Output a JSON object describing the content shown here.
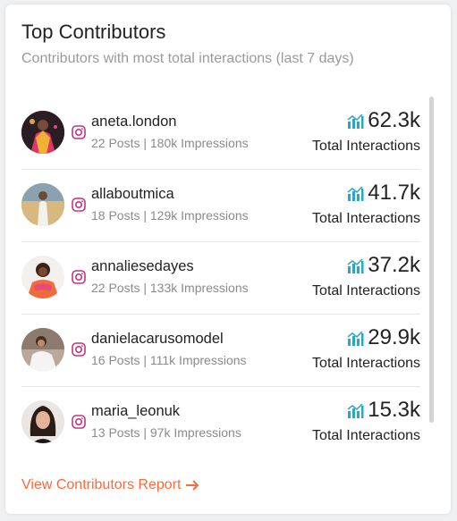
{
  "widget": {
    "title": "Top Contributors",
    "subtitle": "Contributors with most total interactions (last 7 days)",
    "link_label": "View Contributors Report"
  },
  "contributors": [
    {
      "username": "aneta.london",
      "meta": "22 Posts | 180k Impressions",
      "value": "62.3k",
      "value_label": "Total Interactions"
    },
    {
      "username": "allaboutmica",
      "meta": "18 Posts | 129k Impressions",
      "value": "41.7k",
      "value_label": "Total Interactions"
    },
    {
      "username": "annaliesedayes",
      "meta": "22 Posts | 133k Impressions",
      "value": "37.2k",
      "value_label": "Total Interactions"
    },
    {
      "username": "danielacarusomodel",
      "meta": "16 Posts | 111k Impressions",
      "value": "29.9k",
      "value_label": "Total Interactions"
    },
    {
      "username": "maria_leonuk",
      "meta": "13 Posts | 97k Impressions",
      "value": "15.3k",
      "value_label": "Total Interactions"
    }
  ],
  "icons": {
    "network": "instagram-icon",
    "metric": "bar-chart-icon",
    "link": "arrow-right-icon"
  },
  "colors": {
    "instagram": "#c13584",
    "metric_icon": "#2aa6c9",
    "link": "#f26d3d",
    "title": "#222222",
    "subtitle": "#9a9a9a"
  }
}
